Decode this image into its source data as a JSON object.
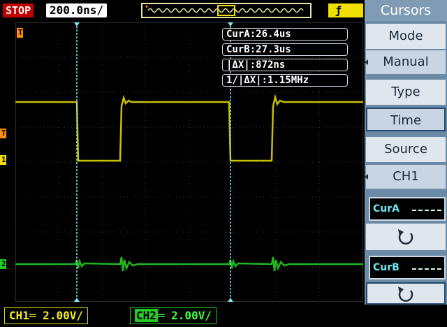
{
  "status": {
    "run_state": "STOP"
  },
  "timebase": {
    "value": "200.0ns/"
  },
  "trigger": {
    "icon": "rising-edge-icon"
  },
  "readouts": {
    "cur_a": "CurA:26.4us",
    "cur_b": "CurB:27.3us",
    "delta_x": "|ΔX|:872ns",
    "inv_delta_x": "1/|ΔX|:1.15MHz"
  },
  "menu": {
    "title": "Cursors",
    "mode_label": "Mode",
    "mode_value": "Manual",
    "type_label": "Type",
    "type_value": "Time",
    "source_label": "Source",
    "source_value": "CH1",
    "cura_label": "CurA",
    "curb_label": "CurB"
  },
  "channels": {
    "ch1": {
      "name": "CH1",
      "scale": "2.00V/"
    },
    "ch2": {
      "name": "CH2",
      "scale": "2.00V/"
    }
  },
  "markers": {
    "trigger_level": "T",
    "ch1": "1",
    "ch2": "2",
    "trigger_pos": "T"
  },
  "colors": {
    "ch1": "#f0e000",
    "ch2": "#22cc22",
    "cursor": "#7fe6ee",
    "trigger": "#ff8c00",
    "stop": "#c00000"
  }
}
